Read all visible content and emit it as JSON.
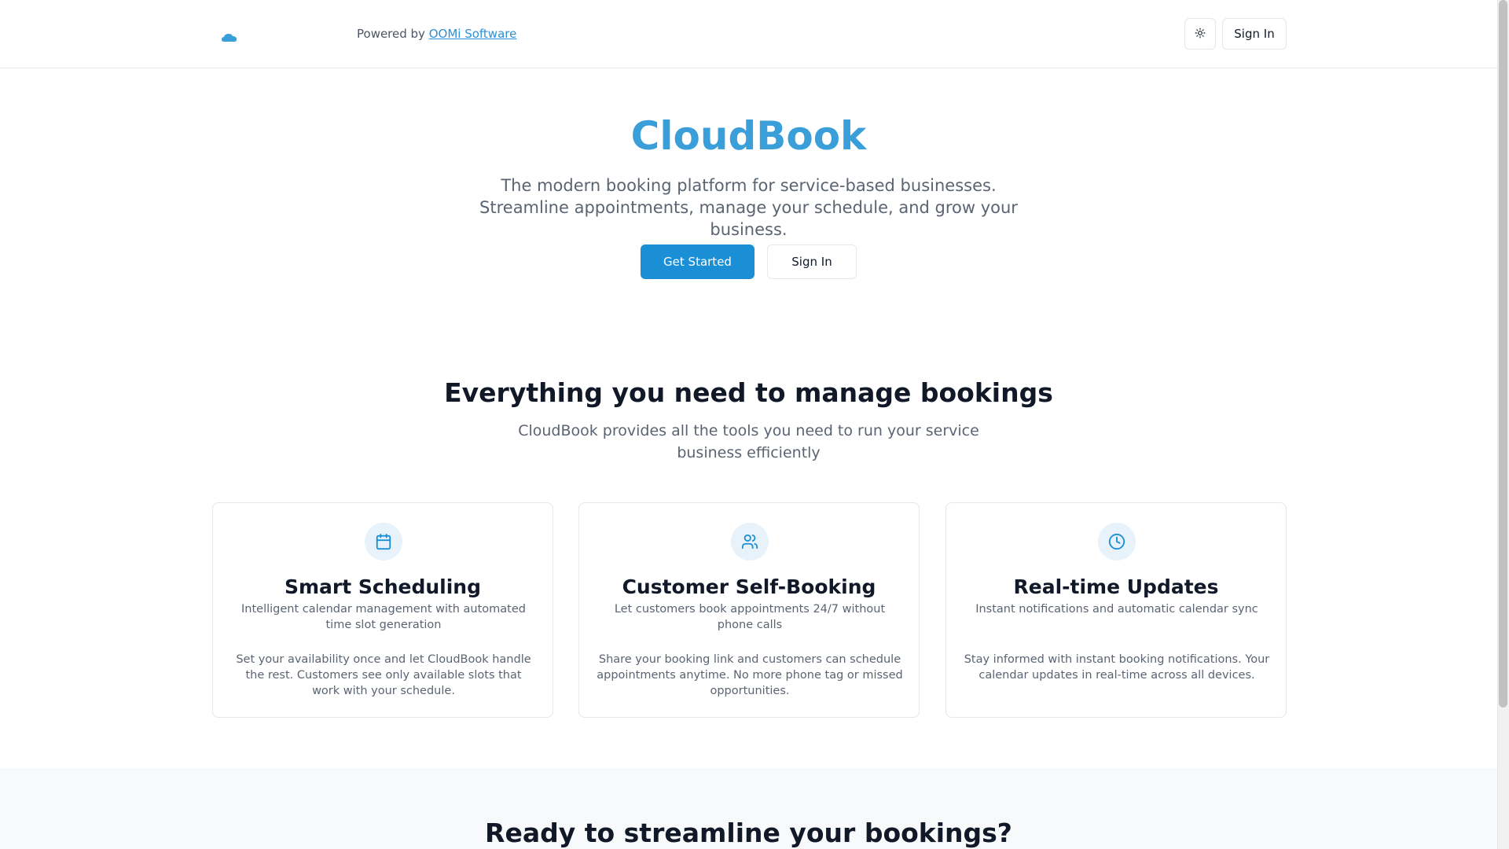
{
  "header": {
    "powered_prefix": "Powered by ",
    "powered_link": "OOMi Software",
    "signin_label": "Sign In",
    "theme_icon": "sun-icon",
    "logo_icon": "cloud-icon"
  },
  "hero": {
    "title": "CloudBook",
    "subtitle": "The modern booking platform for service-based businesses. Streamline appointments, manage your schedule, and grow your business.",
    "primary_button": "Get Started",
    "secondary_button": "Sign In"
  },
  "features": {
    "title": "Everything you need to manage bookings",
    "subtitle": "CloudBook provides all the tools you need to run your service business efficiently",
    "cards": [
      {
        "icon": "calendar-icon",
        "title": "Smart Scheduling",
        "description": "Intelligent calendar management with automated time slot generation",
        "body": "Set your availability once and let CloudBook handle the rest. Customers see only available slots that work with your schedule."
      },
      {
        "icon": "users-icon",
        "title": "Customer Self-Booking",
        "description": "Let customers book appointments 24/7 without phone calls",
        "body": "Share your booking link and customers can schedule appointments anytime. No more phone tag or missed opportunities."
      },
      {
        "icon": "clock-icon",
        "title": "Real-time Updates",
        "description": "Instant notifications and automatic calendar sync",
        "body": "Stay informed with instant booking notifications. Your calendar updates in real-time across all devices."
      }
    ]
  },
  "cta": {
    "title": "Ready to streamline your bookings?"
  },
  "colors": {
    "brand": "#3a9ed9",
    "primary_button": "#1a8fd6",
    "link": "#2b8fd6"
  }
}
